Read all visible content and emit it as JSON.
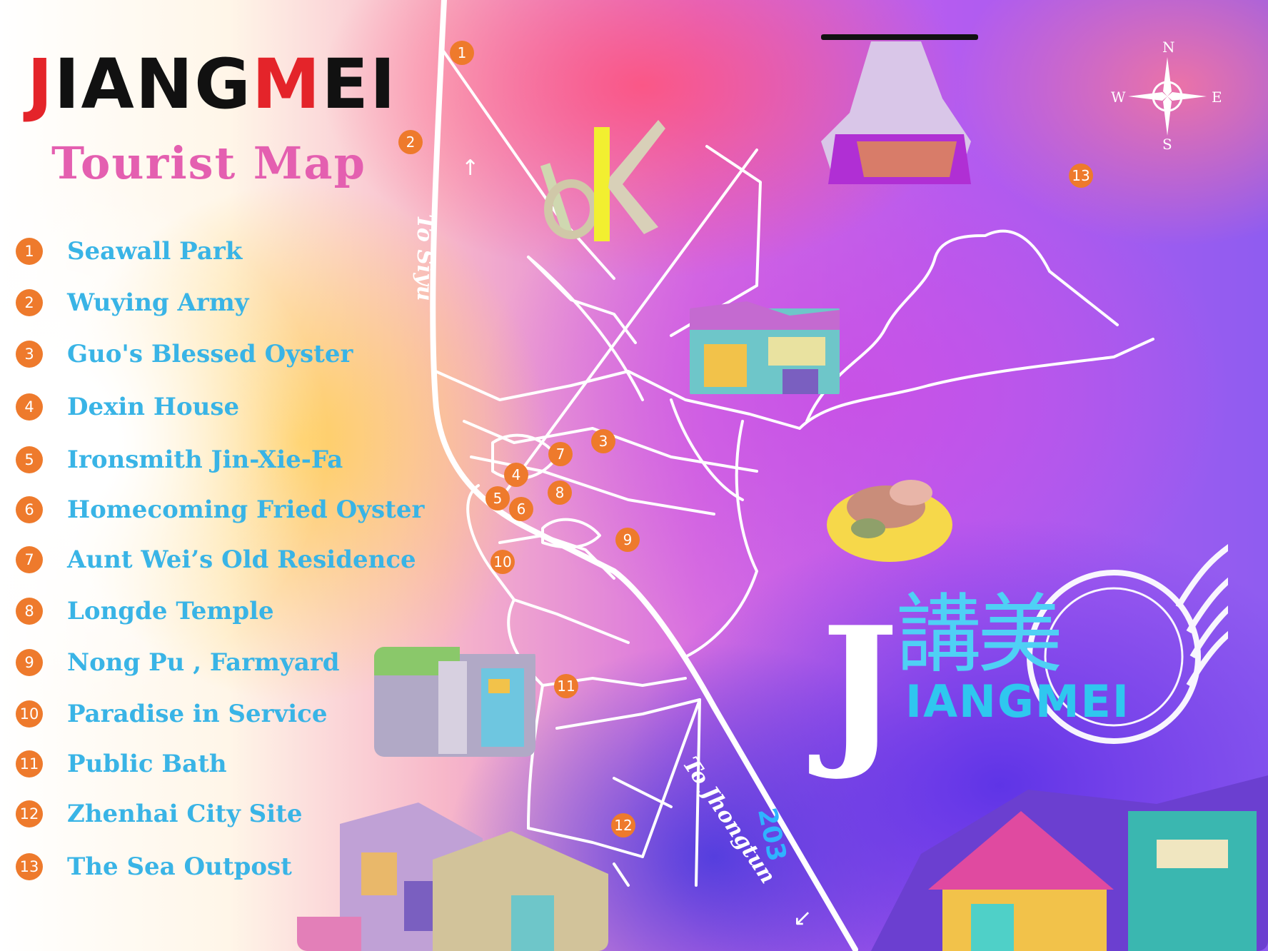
{
  "map": {
    "title": "JIANGMEI",
    "title_first_letter": "J",
    "title_rest_a": "IANG",
    "title_m": "M",
    "title_rest_b": "EI",
    "subtitle": "Tourist  Map",
    "legend": [
      {
        "num": "1",
        "label": "Seawall Park"
      },
      {
        "num": "2",
        "label": "Wuying Army"
      },
      {
        "num": "3",
        "label": "Guo's Blessed Oyster"
      },
      {
        "num": "4",
        "label": "Dexin House"
      },
      {
        "num": "5",
        "label": "Ironsmith Jin-Xie-Fa"
      },
      {
        "num": "6",
        "label": "Homecoming Fried Oyster"
      },
      {
        "num": "7",
        "label": "Aunt Wei’s Old Residence"
      },
      {
        "num": "8",
        "label": "Longde Temple"
      },
      {
        "num": "9",
        "label": "Nong Pu , Farmyard"
      },
      {
        "num": "10",
        "label": "Paradise in Service"
      },
      {
        "num": "11",
        "label": "Public Bath"
      },
      {
        "num": "12",
        "label": "Zhenhai City Site"
      },
      {
        "num": "13",
        "label": "The Sea Outpost"
      }
    ],
    "markers": [
      "1",
      "2",
      "3",
      "4",
      "5",
      "6",
      "7",
      "8",
      "9",
      "10",
      "11",
      "12",
      "13"
    ],
    "road_labels": {
      "north": "To Siyu",
      "south": "To Jhongtun"
    },
    "route_number": "203",
    "compass": {
      "n": "N",
      "s": "S",
      "e": "E",
      "w": "W"
    },
    "brand": {
      "j": "J",
      "chinese": "講美",
      "word": "IANGMEI"
    },
    "colors": {
      "marker": "#ee7a2c",
      "legend_text": "#39b4e6",
      "subtitle": "#e45fb0",
      "title_red": "#e4242a"
    },
    "icons": [
      "compass-rose-icon",
      "arrow-up-icon",
      "arrow-down-right-icon"
    ]
  }
}
